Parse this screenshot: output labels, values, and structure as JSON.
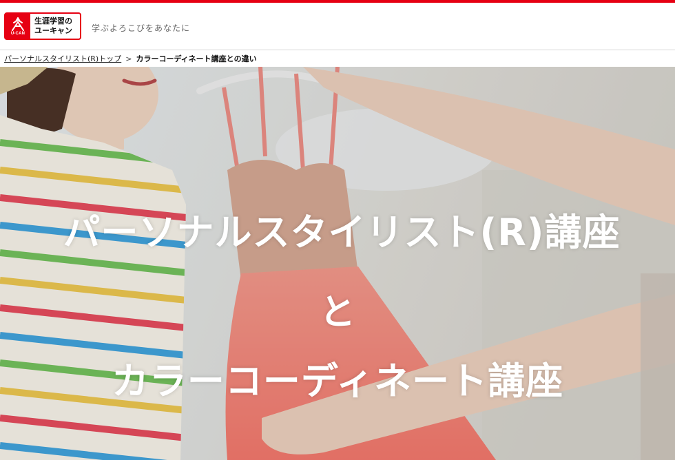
{
  "colors": {
    "brand": "#e60012",
    "breadcrumb_border": "#d5d5d5",
    "hero_text": "#ffffff"
  },
  "header": {
    "logo": {
      "line1": "生涯学習の",
      "line2": "ユーキャン",
      "emblem_text": "U-CAN",
      "icon": "ucan-logo-emblem"
    },
    "tagline": "学ぶよろこびをあなたに"
  },
  "breadcrumb": {
    "parent": "パーソナルスタイリスト(R)トップ",
    "separator": ">",
    "current": "カラーコーディネート講座との違い"
  },
  "hero": {
    "line1": "パーソナルスタイリスト(R)講座",
    "line2": "と",
    "line3": "カラーコーディネート講座"
  }
}
